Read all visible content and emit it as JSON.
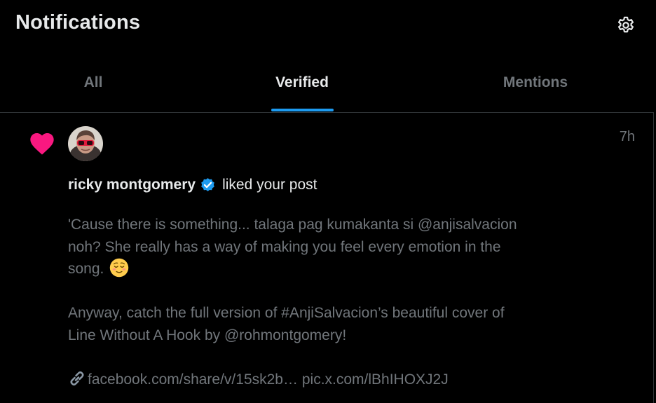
{
  "header": {
    "title": "Notifications",
    "settings_icon": "gear-icon"
  },
  "tabs": [
    {
      "label": "All",
      "active": false
    },
    {
      "label": "Verified",
      "active": true
    },
    {
      "label": "Mentions",
      "active": false
    }
  ],
  "colors": {
    "accent": "#1d9bf0",
    "like": "#f91880",
    "text_primary": "#e7e9ea",
    "text_secondary": "#71767b",
    "background": "#000000",
    "border": "#2f3336"
  },
  "notification": {
    "type_icon": "heart-icon",
    "timestamp": "7h",
    "user_name": "ricky montgomery",
    "verified_icon": "verified-badge-icon",
    "action_text": "liked your post",
    "post": {
      "line1": "'Cause there is something... talaga pag kumakanta si @anjisalvacion",
      "line2": "noh? She really has a way of making you feel every emotion in the",
      "line3": "song.",
      "emoji": "relieved-face-emoji",
      "line4": "Anyway, catch the full version of #AnjiSalvacion’s beautiful cover of",
      "line5": "Line Without A Hook by @rohmontgomery!",
      "link_icon": "link-icon",
      "link1": "facebook.com/share/v/15sk2b…",
      "link2": "pic.x.com/lBhIHOXJ2J"
    }
  }
}
